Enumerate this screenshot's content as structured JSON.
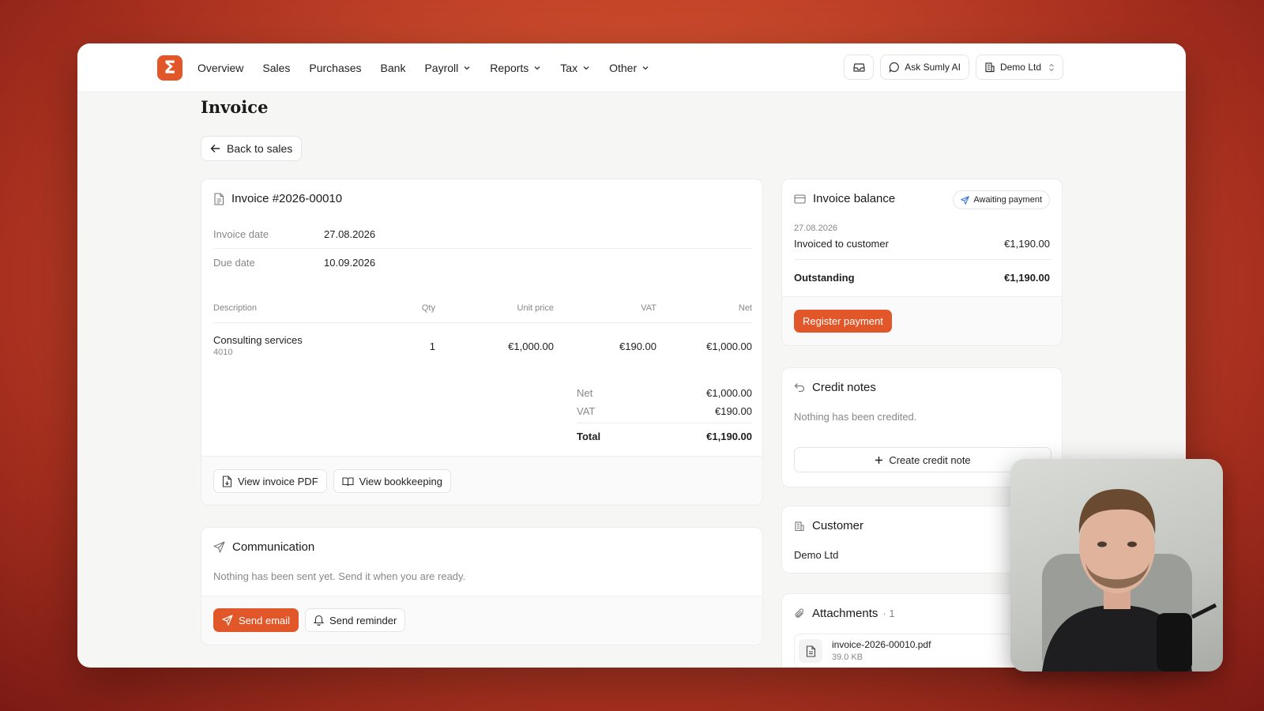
{
  "nav": {
    "items": [
      "Overview",
      "Sales",
      "Purchases",
      "Bank"
    ],
    "dropdowns": [
      "Payroll",
      "Reports",
      "Tax",
      "Other"
    ]
  },
  "top_actions": {
    "inbox_icon": "inbox-icon",
    "ask_ai": "Ask Sumly AI",
    "company": "Demo Ltd"
  },
  "page": {
    "title": "Invoice",
    "back": "Back to sales"
  },
  "invoice": {
    "title": "Invoice #2026-00010",
    "date_label": "Invoice date",
    "date_value": "27.08.2026",
    "due_label": "Due date",
    "due_value": "10.09.2026",
    "columns": [
      "Description",
      "Qty",
      "Unit price",
      "VAT",
      "Net"
    ],
    "line": {
      "description": "Consulting services",
      "code": "4010",
      "qty": "1",
      "unit_price": "€1,000.00",
      "vat": "€190.00",
      "net": "€1,000.00"
    },
    "totals": {
      "net_label": "Net",
      "net_value": "€1,000.00",
      "vat_label": "VAT",
      "vat_value": "€190.00",
      "total_label": "Total",
      "total_value": "€1,190.00"
    },
    "view_pdf": "View invoice PDF",
    "view_bookkeeping": "View bookkeeping"
  },
  "communication": {
    "title": "Communication",
    "empty": "Nothing has been sent yet. Send it when you are ready.",
    "send_email": "Send email",
    "send_reminder": "Send reminder"
  },
  "balance": {
    "title": "Invoice balance",
    "status": "Awaiting payment",
    "date": "27.08.2026",
    "invoiced_label": "Invoiced to customer",
    "invoiced_value": "€1,190.00",
    "outstanding_label": "Outstanding",
    "outstanding_value": "€1,190.00",
    "register": "Register payment"
  },
  "credit_notes": {
    "title": "Credit notes",
    "empty": "Nothing has been credited.",
    "create": "Create credit note"
  },
  "customer": {
    "title": "Customer",
    "name": "Demo Ltd"
  },
  "attachments": {
    "title": "Attachments",
    "count": "· 1",
    "file_name": "invoice-2026-00010.pdf",
    "file_size": "39.0 KB"
  },
  "colors": {
    "accent": "#e2572a"
  }
}
